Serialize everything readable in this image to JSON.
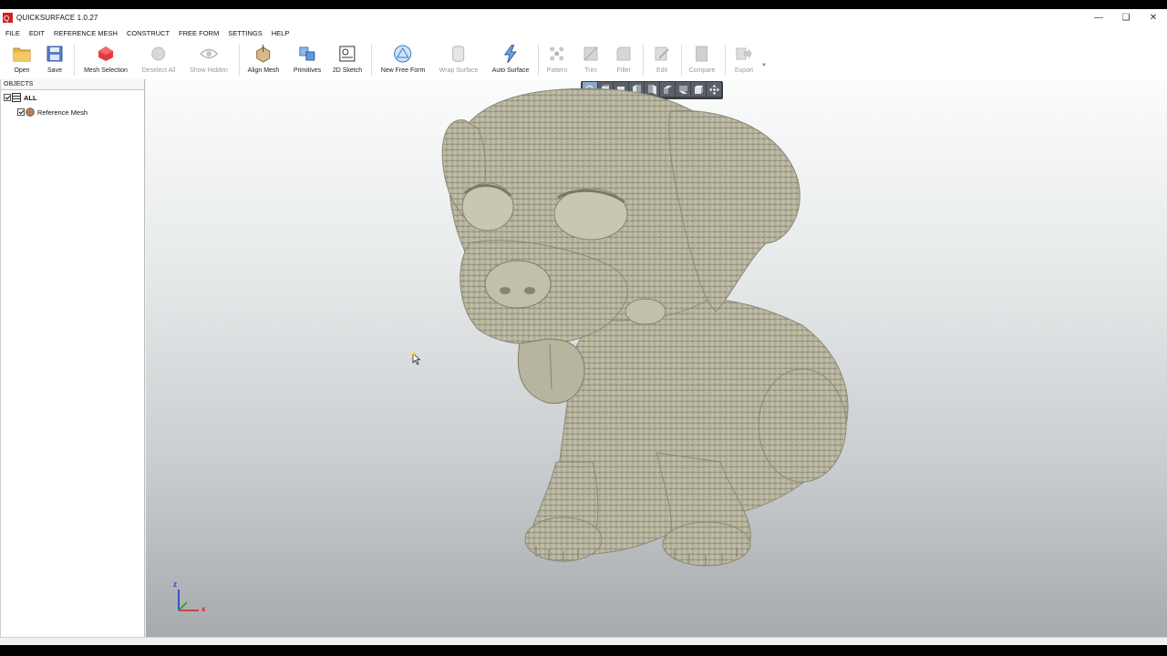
{
  "app": {
    "title": "QUICKSURFACE 1.0.27",
    "window_controls": [
      "minimize-icon",
      "restore-icon",
      "close-icon"
    ]
  },
  "menu": [
    "FILE",
    "EDIT",
    "REFERENCE MESH",
    "CONSTRUCT",
    "FREE FORM",
    "SETTINGS",
    "HELP"
  ],
  "toolbar": {
    "open": "Open",
    "save": "Save",
    "mesh_selection": "Mesh Selection",
    "deselect_all": "Deselect All",
    "show_hidden": "Show Hidden",
    "align_mesh": "Align Mesh",
    "primitives": "Primitives",
    "sketch_2d": "2D Sketch",
    "new_free_form": "New Free Form",
    "wrap_surface": "Wrap Surface",
    "auto_surface": "Auto Surface",
    "pattern": "Pattern",
    "trim": "Trim",
    "fillet": "Fillet",
    "edit": "Edit",
    "compare": "Compare",
    "export": "Export"
  },
  "objects_panel": {
    "header": "OBJECTS",
    "root": "ALL",
    "children": [
      "Reference Mesh"
    ]
  },
  "viewport": {
    "axes": {
      "x": "x",
      "z": "z"
    },
    "view_buttons": [
      "zoom-fit-icon",
      "front-view-icon",
      "back-view-icon",
      "left-view-icon",
      "right-view-icon",
      "top-view-icon",
      "bottom-view-icon",
      "iso-view-icon",
      "pan-rotate-icon"
    ]
  },
  "colors": {
    "mesh": "#b9b7a0",
    "accent_red": "#e23a3a",
    "accent_blue": "#3a7cc9"
  }
}
